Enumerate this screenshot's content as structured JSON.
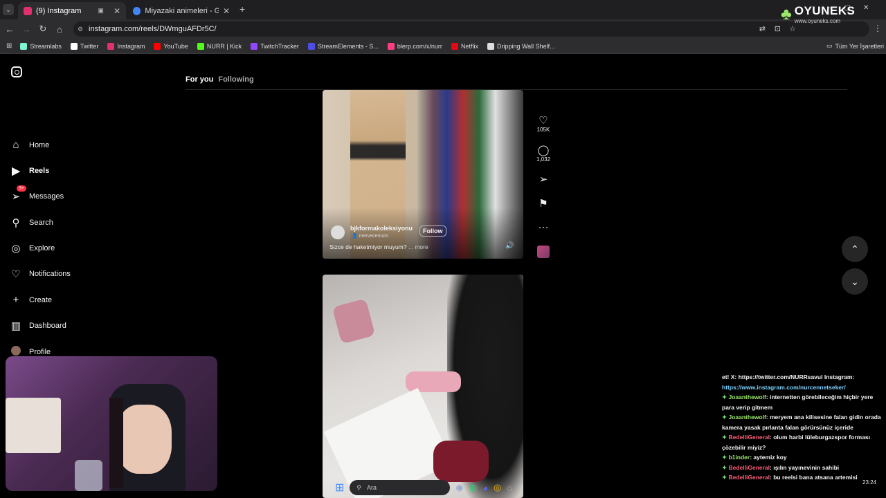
{
  "browser": {
    "tabs": [
      {
        "title": "(9) Instagram",
        "favicon_color": "#e1306c"
      },
      {
        "title": "Miyazaki animeleri - Google'da",
        "favicon_color": "#4285f4"
      }
    ],
    "new_tab": "+",
    "url": "instagram.com/reels/DWmguAFDr5C/",
    "bookmarks": [
      {
        "label": "Streamlabs",
        "color": "#80f5d2"
      },
      {
        "label": "Twitter",
        "color": "#ffffff"
      },
      {
        "label": "Instagram",
        "color": "#e1306c"
      },
      {
        "label": "YouTube",
        "color": "#ff0000"
      },
      {
        "label": "NURR | Kick",
        "color": "#53fc18"
      },
      {
        "label": "TwitchTracker",
        "color": "#9146ff"
      },
      {
        "label": "StreamElements - S...",
        "color": "#4e4ee6"
      },
      {
        "label": "blerp.com/x/nurr",
        "color": "#ff3e7f"
      },
      {
        "label": "Netflix",
        "color": "#e50914"
      },
      {
        "label": "Dripping Wall Shelf...",
        "color": "#dddddd"
      }
    ],
    "all_bookmarks": "Tüm Yer İşaretleri"
  },
  "instagram": {
    "nav": [
      {
        "label": "Home",
        "icon": "home-icon"
      },
      {
        "label": "Reels",
        "icon": "reels-icon"
      },
      {
        "label": "Messages",
        "icon": "messages-icon",
        "badge": "9+"
      },
      {
        "label": "Search",
        "icon": "search-icon"
      },
      {
        "label": "Explore",
        "icon": "explore-icon"
      },
      {
        "label": "Notifications",
        "icon": "heart-icon"
      },
      {
        "label": "Create",
        "icon": "plus-icon"
      },
      {
        "label": "Dashboard",
        "icon": "dashboard-icon"
      },
      {
        "label": "Profile",
        "icon": "avatar"
      }
    ],
    "feed_tabs": {
      "for_you": "For you",
      "following": "Following"
    },
    "reel1": {
      "username": "bjkformakoleksiyonu",
      "collab": "mervecemum",
      "follow": "Follow",
      "caption": "Sizce de haketmiyor muyum?",
      "more": "... more",
      "likes": "105K",
      "comments": "1,032"
    }
  },
  "overlay": {
    "logo_text": "OYUNEKS",
    "logo_sub": "www.oyuneks.com",
    "chat": [
      {
        "user": "",
        "text": "et! X: https://twitter.com/NURRsavul Instagram:"
      },
      {
        "user": "",
        "text": "https://www.instagram.com/nurcennetseker/",
        "link": true
      },
      {
        "user": "Joaanthewolf",
        "text": ": internetten görebileceğim hiçbir yere para verip gitmem"
      },
      {
        "user": "Joaanthewolf",
        "text": ": meryem ana kilisesine falan gidin orada kamera yasak pırlanta falan görürsünüz içeride"
      },
      {
        "user": "BedelliGeneral",
        "text": ": olum harbi lüleburgazspor forması çözebilir miyiz?"
      },
      {
        "user": "b1inder",
        "text": ": aytemiz koy"
      },
      {
        "user": "BedelliGeneral",
        "text": ": ışılın yayınevinin sahibi"
      },
      {
        "user": "BedelliGeneral",
        "text": ": bu reelsi bana atsana artemisi"
      }
    ],
    "taskbar_search": "Ara",
    "clock": "23:24"
  }
}
